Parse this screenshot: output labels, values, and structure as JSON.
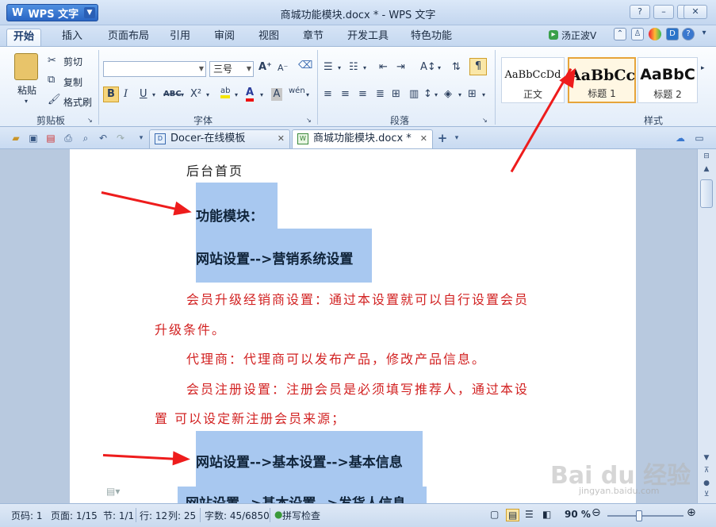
{
  "window": {
    "app_button": "WPS 文字",
    "title": "商城功能模块.docx * - WPS 文字",
    "controls": [
      "?",
      "–",
      "□",
      "✕"
    ]
  },
  "ribbon_tabs": [
    "开始",
    "插入",
    "页面布局",
    "引用",
    "审阅",
    "视图",
    "章节",
    "开发工具",
    "特色功能"
  ],
  "user": "汤正波V",
  "clipboard": {
    "paste": "粘贴",
    "cut": "剪切",
    "copy": "复制",
    "format_painter": "格式刷",
    "group": "剪贴板"
  },
  "font": {
    "font_name": "",
    "font_size": "三号",
    "bold": "B",
    "italic": "I",
    "underline": "U",
    "strike": "ABC",
    "superscript": "X²",
    "highlight": "ab",
    "font_color": "A",
    "shade": "A",
    "pinyin": "wén",
    "group": "字体"
  },
  "paragraph": {
    "group": "段落"
  },
  "styles": {
    "items": [
      {
        "sample": "AaBbCcDd",
        "name": "正文"
      },
      {
        "sample": "AaBbCc",
        "name": "标题 1"
      },
      {
        "sample": "AaBbC",
        "name": "标题 2"
      }
    ],
    "group": "样式"
  },
  "doc_tabs": [
    {
      "label": "Docer-在线模板"
    },
    {
      "label": "商城功能模块.docx *"
    }
  ],
  "document": {
    "line1": "后台首页",
    "heading1": "功能模块：",
    "heading2": "网站设置-->营销系统设置",
    "p1a": "会员升级经销商设置：通过本设置就可以自行设置会员",
    "p1b": "升级条件。",
    "p2": "代理商：代理商可以发布产品，修改产品信息。",
    "p3a": "会员注册设置：注册会员是必须填写推荐人，通过本设",
    "p3b": "置  可以设定新注册会员来源；",
    "heading3": "网站设置-->基本设置-->基本信息",
    "heading4": "网站设置-->基本设置-->发货人信息"
  },
  "status": {
    "page_code": "页码: 1",
    "page": "页面: 1/15",
    "section": "节: 1/1",
    "row": "行: 12",
    "col": "列: 25",
    "words": "字数: 45/6850",
    "spell": "拼写检查",
    "zoom": "90 %"
  },
  "watermark": {
    "text": "Bai du 经验",
    "sub": "jingyan.baidu.com"
  },
  "colors": {
    "highlight": "#a8c8f0",
    "red_text": "#d22222",
    "arrow": "#ee1c1c"
  }
}
